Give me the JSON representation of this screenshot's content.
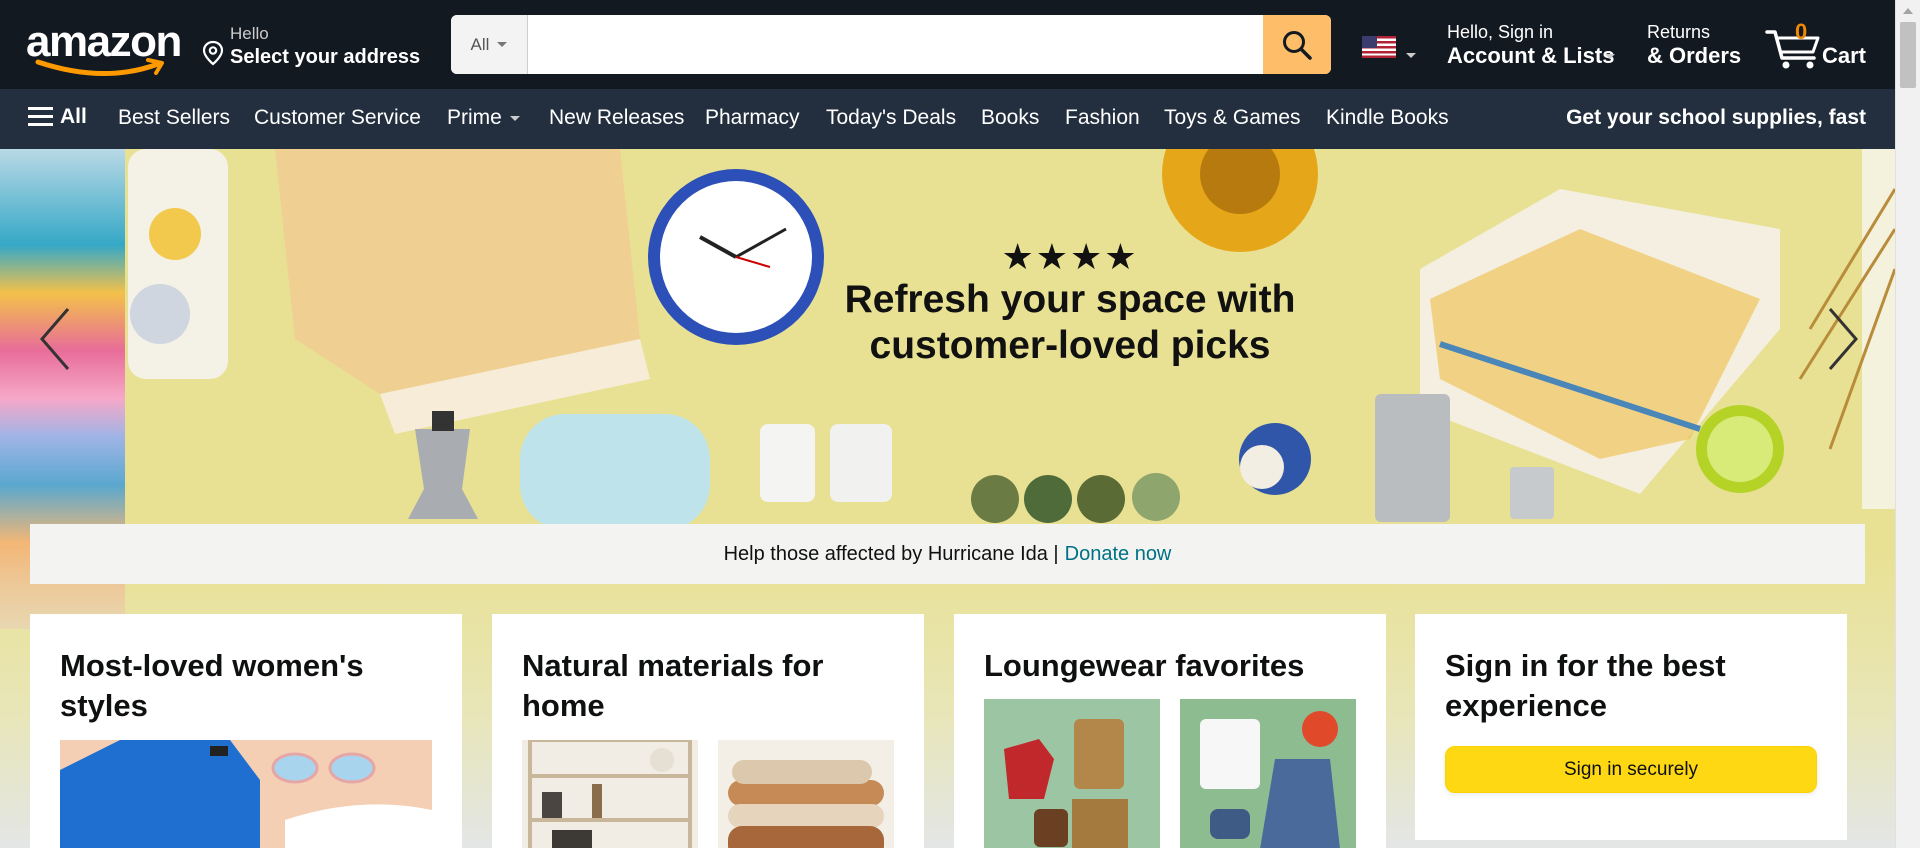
{
  "header": {
    "logo_text": "amazon",
    "address": {
      "line1": "Hello",
      "line2": "Select your address"
    },
    "search": {
      "category": "All",
      "placeholder": "",
      "value": ""
    },
    "account": {
      "line1": "Hello, Sign in",
      "line2": "Account & Lists"
    },
    "returns": {
      "line1": "Returns",
      "line2": "& Orders"
    },
    "cart": {
      "count": "0",
      "label": "Cart"
    }
  },
  "subnav": {
    "all": "All",
    "items": [
      "Best Sellers",
      "Customer Service",
      "Prime",
      "New Releases",
      "Pharmacy",
      "Today's Deals",
      "Books",
      "Fashion",
      "Toys & Games",
      "Kindle Books"
    ],
    "promo": "Get your school supplies, fast"
  },
  "hero": {
    "stars": "★★★★",
    "headline_line1": "Refresh your space with",
    "headline_line2": "customer-loved picks"
  },
  "notice": {
    "text": "Help those affected by Hurricane Ida |",
    "link": "Donate now"
  },
  "cards": [
    {
      "title": "Most-loved women's styles"
    },
    {
      "title": "Natural materials for home"
    },
    {
      "title": "Loungewear favorites"
    },
    {
      "title": "Sign in for the best experience",
      "button": "Sign in securely"
    }
  ],
  "colors": {
    "nav_bg": "#131921",
    "subnav_bg": "#232f3e",
    "search_button": "#febd69",
    "cart_count": "#f08804",
    "link": "#007185",
    "signin_button": "#ffd814",
    "hero_bg": "#e8e193"
  }
}
